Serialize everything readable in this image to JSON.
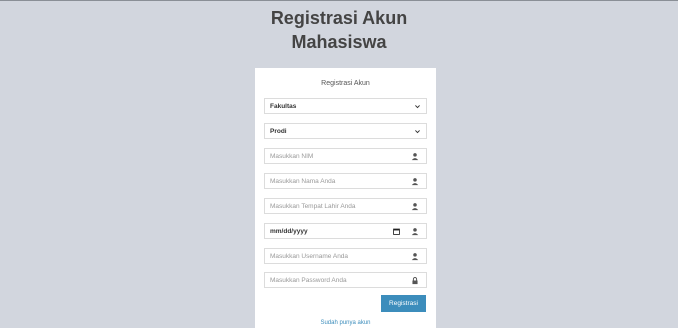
{
  "header": {
    "title_line1": "Registrasi Akun",
    "title_line2": "Mahasiswa"
  },
  "form": {
    "title": "Registrasi Akun",
    "fakultas": "Fakultas",
    "prodi": "Prodi",
    "nim_placeholder": "Masukkan NIM",
    "nama_placeholder": "Masukkan Nama Anda",
    "tempat_lahir_placeholder": "Masukkan Tempat Lahir Anda",
    "date_placeholder": "mm/dd/yyyy",
    "username_placeholder": "Masukkan Username Anda",
    "password_placeholder": "Masukkan Password Anda",
    "submit_label": "Registrasi",
    "login_link": "Sudah punya akun"
  },
  "colors": {
    "background": "#d2d6de",
    "accent": "#3c8dbc"
  },
  "icons": {
    "user": "user-icon",
    "lock": "lock-icon",
    "calendar": "calendar-icon",
    "chevron": "chevron-down-icon"
  }
}
